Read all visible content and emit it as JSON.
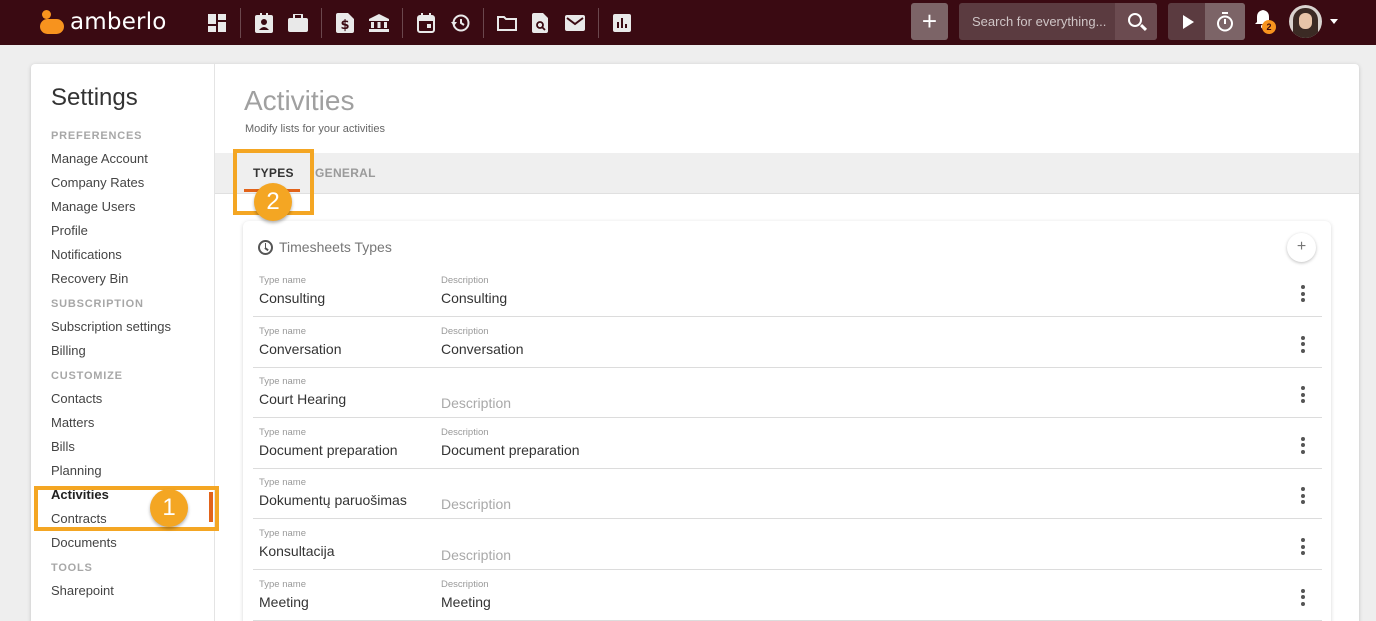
{
  "header": {
    "brand": "amberlo",
    "search_placeholder": "Search for everything...",
    "plus_label": "+",
    "notifications_count": "2",
    "nav_icons": [
      "dashboard-icon",
      "contacts-icon",
      "matters-icon",
      "bills-icon",
      "bank-icon",
      "calendar-icon",
      "time-history-icon",
      "folder-icon",
      "document-search-icon",
      "mail-icon",
      "reports-icon"
    ]
  },
  "sidebar": {
    "title": "Settings",
    "sections": [
      {
        "heading": "PREFERENCES",
        "items": [
          "Manage Account",
          "Company Rates",
          "Manage Users",
          "Profile",
          "Notifications",
          "Recovery Bin"
        ]
      },
      {
        "heading": "SUBSCRIPTION",
        "items": [
          "Subscription settings",
          "Billing"
        ]
      },
      {
        "heading": "CUSTOMIZE",
        "items": [
          "Contacts",
          "Matters",
          "Bills",
          "Planning",
          "Activities",
          "Contracts",
          "Documents"
        ]
      },
      {
        "heading": "TOOLS",
        "items": [
          "Sharepoint"
        ]
      }
    ],
    "active_item": "Activities"
  },
  "main": {
    "title": "Activities",
    "subtitle": "Modify lists for your activities",
    "tabs": [
      {
        "label": "TYPES",
        "active": true
      },
      {
        "label": "GENERAL",
        "active": false
      }
    ]
  },
  "panel": {
    "title": "Timesheets Types",
    "add_label": "+",
    "col_type_label": "Type name",
    "col_desc_label": "Description",
    "desc_placeholder": "Description",
    "rows": [
      {
        "type": "Consulting",
        "description": "Consulting"
      },
      {
        "type": "Conversation",
        "description": "Conversation"
      },
      {
        "type": "Court Hearing",
        "description": ""
      },
      {
        "type": "Document preparation",
        "description": "Document preparation"
      },
      {
        "type": "Dokumentų paruošimas",
        "description": ""
      },
      {
        "type": "Konsultacija",
        "description": ""
      },
      {
        "type": "Meeting",
        "description": "Meeting"
      }
    ]
  },
  "callouts": {
    "step1": "1",
    "step2": "2"
  },
  "colors": {
    "topbar": "#3a0a12",
    "brand_orange": "#f7931e",
    "callout": "#f4a623",
    "tab_underline": "#e2631a"
  }
}
